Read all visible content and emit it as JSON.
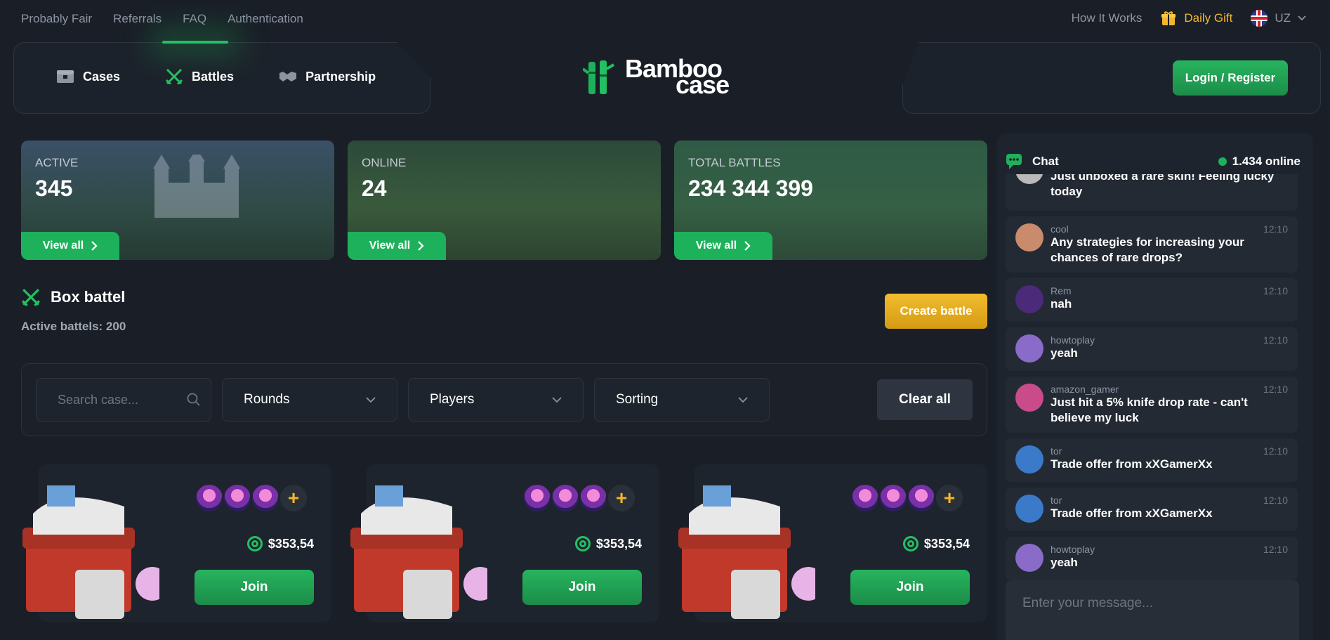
{
  "topnav": {
    "links": [
      "Probably Fair",
      "Referrals",
      "FAQ",
      "Authentication"
    ],
    "how_it_works": "How It Works",
    "daily_gift": "Daily Gift",
    "lang": "UZ"
  },
  "nav": {
    "items": [
      {
        "label": "Cases",
        "icon": "chest-icon"
      },
      {
        "label": "Battles",
        "icon": "crossed-swords-icon"
      },
      {
        "label": "Partnership",
        "icon": "handshake-icon"
      }
    ],
    "active": "Battles"
  },
  "logo": {
    "line1": "Bamboo",
    "line2": "case"
  },
  "login_label": "Login / Register",
  "stats": [
    {
      "label": "ACTIVE",
      "value": "345",
      "button": "View all"
    },
    {
      "label": "ONLINE",
      "value": "24",
      "button": "View all"
    },
    {
      "label": "TOTAL BATTLES",
      "value": "234 344 399",
      "button": "View all"
    }
  ],
  "box_battle": {
    "title": "Box battel",
    "subtitle": "Active battels: 200",
    "create_label": "Create battle"
  },
  "filters": {
    "search_placeholder": "Search case...",
    "rounds": "Rounds",
    "players": "Players",
    "sorting": "Sorting",
    "clear_label": "Clear all"
  },
  "battles": [
    {
      "price": "$353,54",
      "join_label": "Join",
      "add": "+"
    },
    {
      "price": "$353,54",
      "join_label": "Join",
      "add": "+"
    },
    {
      "price": "$353,54",
      "join_label": "Join",
      "add": "+"
    }
  ],
  "chat": {
    "title": "Chat",
    "online": "1.434 online",
    "input_placeholder": "Enter your message...",
    "messages": [
      {
        "name": "",
        "time": "",
        "text": "Just unboxed a rare skin! Feeling lucky today",
        "avatar_color": "#b9b9b9"
      },
      {
        "name": "cool",
        "time": "12:10",
        "text": "Any strategies for increasing your chances of rare drops?",
        "avatar_color": "#c98b6b"
      },
      {
        "name": "Rem",
        "time": "12:10",
        "text": "nah",
        "avatar_color": "#4b2a7a"
      },
      {
        "name": "howtoplay",
        "time": "12:10",
        "text": "yeah",
        "avatar_color": "#8a6bc9"
      },
      {
        "name": "amazon_gamer",
        "time": "12:10",
        "text": "Just hit a 5% knife drop rate - can't believe my luck",
        "avatar_color": "#c94b8a"
      },
      {
        "name": "tor",
        "time": "12:10",
        "text": "Trade offer from xXGamerXx",
        "avatar_color": "#3b7ac9"
      },
      {
        "name": "tor",
        "time": "12:10",
        "text": "Trade offer from xXGamerXx",
        "avatar_color": "#3b7ac9"
      },
      {
        "name": "howtoplay",
        "time": "12:10",
        "text": "yeah",
        "avatar_color": "#8a6bc9"
      }
    ]
  },
  "colors": {
    "accent_green": "#1eb15b",
    "accent_gold": "#f2b62b",
    "bg": "#1a1f27"
  }
}
